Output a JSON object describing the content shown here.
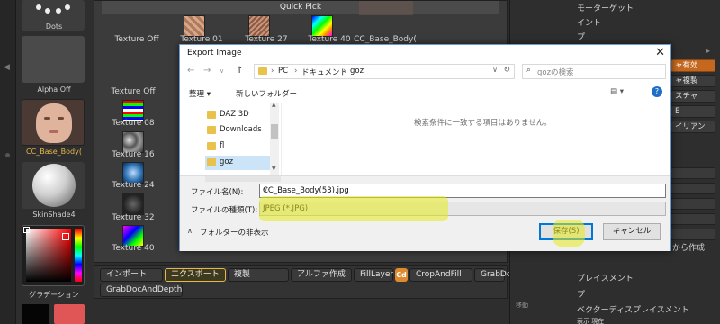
{
  "left_thumbs": {
    "dots_label": "Dots",
    "alpha_label": "Alpha Off",
    "body_label": "CC_Base_Body(",
    "sphere_label": "SkinShade4",
    "gradient_label": "グラデーション"
  },
  "quick_pick": {
    "header": "Quick Pick",
    "row1": [
      "Texture Off",
      "Texture 01",
      "Texture 27",
      "Texture 40",
      "CC_Base_Body("
    ],
    "left_labels": [
      "Texture Off",
      "Texture 08",
      "Texture 16",
      "Texture 24",
      "Texture 32",
      "Texture 40"
    ]
  },
  "bottom_bar": {
    "import": "インポート",
    "export": "エクスポート",
    "duplicate": "複製",
    "make_alpha": "アルファ作成",
    "fill_layer": "FillLayer",
    "cd_icon": "Cd",
    "crop_and_fill": "CropAndFill",
    "grab_doc": "GrabDoc",
    "grab_doc_depth": "GrabDocAndDepth"
  },
  "right_panel": {
    "top_text": "モーターゲット",
    "line2": "イント",
    "line3": "プ",
    "active_button": "ャ有効",
    "btn_copy": "ャ複製",
    "btn_texture": "スチャ",
    "btn_e": "E",
    "btn_ia": "イリアン",
    "make_rope": "から作成",
    "displacement": "プレイスメント",
    "map": "プ",
    "vector_disp": "ベクターディスプレイスメント",
    "move": "移動",
    "bottom": "表示 現在"
  },
  "dialog": {
    "title": "Export Image",
    "breadcrumb": [
      "PC",
      "ドキュメント",
      "goz"
    ],
    "search_placeholder": "gozの検索",
    "organize": "整理 ▾",
    "new_folder": "新しいフォルダー",
    "nav_items": [
      {
        "label": "DAZ 3D",
        "selected": false
      },
      {
        "label": "Downloads",
        "selected": false
      },
      {
        "label": "fl",
        "selected": false
      },
      {
        "label": "goz",
        "selected": true
      }
    ],
    "empty_message": "検索条件に一致する項目はありません。",
    "filename_label": "ファイル名(N):",
    "filename_value": "CC_Base_Body(53).jpg",
    "filetype_label": "ファイルの種類(T):",
    "filetype_value": "JPEG (*.JPG)",
    "hide_folders": "フォルダーの非表示",
    "save_button": "保存(S)",
    "cancel_button": "キャンセル",
    "accent_color": "#0078d7"
  }
}
